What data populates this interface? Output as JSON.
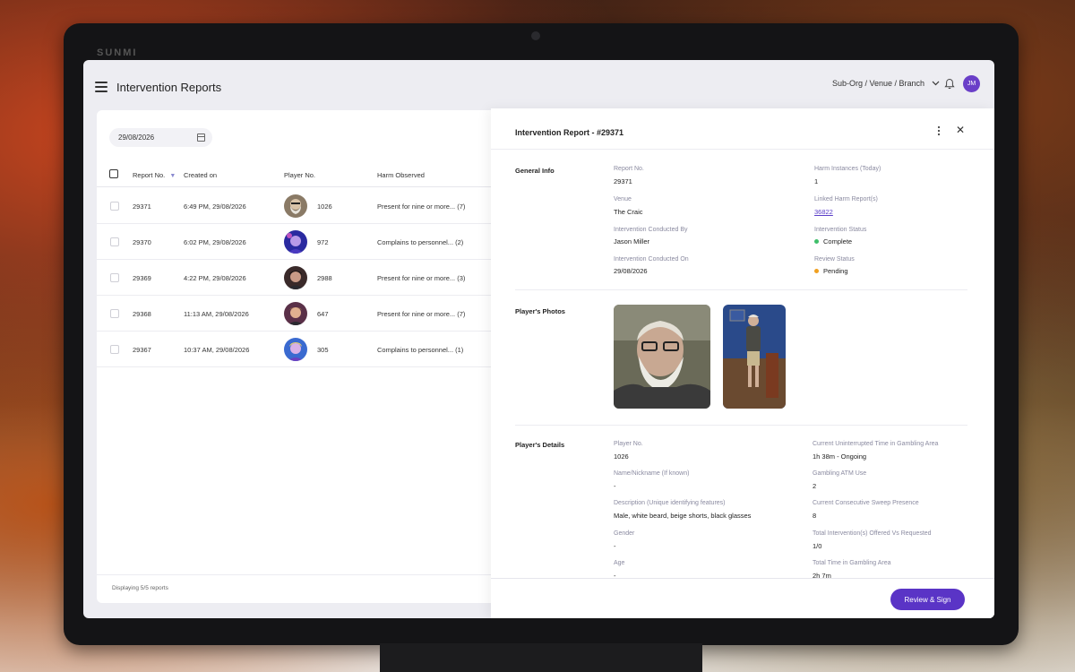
{
  "device": {
    "brand": "SUNMI"
  },
  "header": {
    "title": "Intervention Reports",
    "org_select": "Sub-Org / Venue / Branch",
    "avatar_initials": "JM"
  },
  "list": {
    "date_filter": "29/08/2026",
    "columns": [
      "Report No.",
      "Created on",
      "Player No.",
      "Harm Observed"
    ],
    "rows": [
      {
        "report_no": "29371",
        "created_on": "6:49 PM, 29/08/2026",
        "player_no": "1026",
        "harm": "Present for nine or more... (7)"
      },
      {
        "report_no": "29370",
        "created_on": "6:02 PM, 29/08/2026",
        "player_no": "972",
        "harm": "Complains to personnel... (2)"
      },
      {
        "report_no": "29369",
        "created_on": "4:22 PM, 29/08/2026",
        "player_no": "2988",
        "harm": "Present for nine or more... (3)"
      },
      {
        "report_no": "29368",
        "created_on": "11:13 AM, 29/08/2026",
        "player_no": "647",
        "harm": "Present for nine or more... (7)"
      },
      {
        "report_no": "29367",
        "created_on": "10:37 AM, 29/08/2026",
        "player_no": "305",
        "harm": "Complains to personnel... (1)"
      }
    ],
    "footer": "Displaying 5/5 reports"
  },
  "detail": {
    "title": "Intervention Report - #29371",
    "general_info": {
      "section": "General Info",
      "report_no_label": "Report No.",
      "report_no": "29371",
      "venue_label": "Venue",
      "venue": "The Craic",
      "conducted_by_label": "Intervention Conducted By",
      "conducted_by": "Jason Miller",
      "conducted_on_label": "Intervention Conducted On",
      "conducted_on": "29/08/2026",
      "harm_instances_label": "Harm Instances (Today)",
      "harm_instances": "1",
      "linked_label": "Linked Harm Report(s)",
      "linked": "36822",
      "status_label": "Intervention Status",
      "status": "Complete",
      "status_color": "#3fbf6a",
      "review_label": "Review Status",
      "review": "Pending",
      "review_color": "#f0a020"
    },
    "photos_section": "Player's Photos",
    "details": {
      "section": "Player's Details",
      "player_no_label": "Player No.",
      "player_no": "1026",
      "nickname_label": "Name/Nickname (If known)",
      "nickname": "-",
      "description_label": "Description (Unique identifying features)",
      "description": "Male, white beard, beige shorts, black glasses",
      "gender_label": "Gender",
      "gender": "-",
      "age_label": "Age",
      "age": "-",
      "time_label": "Current Uninterrupted Time in Gambling Area",
      "time": "1h 38m - Ongoing",
      "atm_label": "Gambling ATM Use",
      "atm": "2",
      "sweep_label": "Current Consecutive Sweep Presence",
      "sweep": "8",
      "interventions_label": "Total Intervention(s) Offered Vs Requested",
      "interventions": "1/0",
      "total_time_label": "Total Time in Gambling Area",
      "total_time": "2h 7m"
    },
    "action_button": "Review & Sign"
  }
}
